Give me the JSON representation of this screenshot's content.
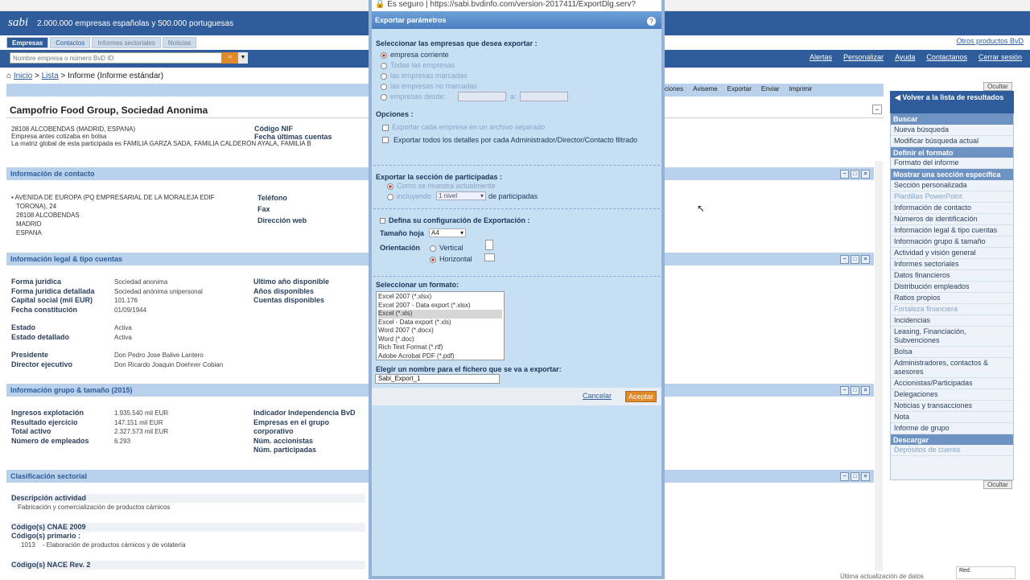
{
  "header": {
    "logo": "sabi",
    "tagline": "2.000.000 empresas españolas y 500.000 portuguesas",
    "tabs": [
      "Empresas",
      "Contactos",
      "Informes sectoriales",
      "Noticias"
    ],
    "otros": "Otros productos BvD"
  },
  "search": {
    "placeholder": "Nombre empresa o número BvD ID"
  },
  "toplinks": [
    "Alertas",
    "Personalizar",
    "Ayuda",
    "Contactanos",
    "Cerrar sesión"
  ],
  "breadcrumb": {
    "inicio": "Inicio",
    "lista": "Lista",
    "rest": " > Informe (Informe estándar)"
  },
  "actions": [
    "ciones",
    "Aviseme",
    "Exportar",
    "Enviar",
    "Imprimir"
  ],
  "company": {
    "name": "Campofrio Food Group, Sociedad Anonima",
    "line1": "28108 ALCOBENDAS (MADRID, ESPANA)",
    "line2": "Empresa antes cotizaba en bolsa",
    "line3": "La matriz global de esta participada es FAMILIA GARZA SADA, FAMILIA CALDERÓN AYALA, FAMILIA B",
    "nif_label": "Código NIF",
    "ultimas_label": "Fecha últimas cuentas"
  },
  "contact": {
    "title": "Información de contacto",
    "address": [
      "AVENIDA DE EUROPA (PQ EMPRESARIAL DE LA MORALEJA EDIF",
      "TORONA), 24",
      "28108 ALCOBENDAS",
      "MADRID",
      "ESPANA"
    ],
    "labels": [
      "Teléfono",
      "Fax",
      "Dirección web"
    ]
  },
  "legal": {
    "title": "Información legal & tipo cuentas",
    "rows": [
      {
        "label": "Forma jurídica",
        "value": "Sociedad anonima"
      },
      {
        "label": "Forma jurídica detallada",
        "value": "Sociedad anónima unipersonal"
      },
      {
        "label": "Capital social (mil EUR)",
        "value": "101.176"
      },
      {
        "label": "Fecha constitución",
        "value": "01/09/1944"
      },
      {
        "label": "Estado",
        "value": "Activa"
      },
      {
        "label": "Estado detallado",
        "value": "Activa"
      },
      {
        "label": "Presidente",
        "value": "Don Pedro Jose Balive Lantero"
      },
      {
        "label": "Director ejecutivo",
        "value": "Don Ricardo Joaquin Doehner Cobian"
      }
    ],
    "right_labels": [
      "Ultimo año disponible",
      "Años disponibles",
      "Cuentas disponibles"
    ]
  },
  "grupo": {
    "title": "Información grupo & tamaño (2015)",
    "rows": [
      {
        "label": "Ingresos explotación",
        "value": "1.935.540 mil EUR"
      },
      {
        "label": "Resultado ejercicio",
        "value": "147.151 mil EUR"
      },
      {
        "label": "Total activo",
        "value": "2.327.573 mil EUR"
      },
      {
        "label": "Número de empleados",
        "value": "6.293"
      }
    ],
    "right_labels": [
      "Indicador Independencia BvD",
      "Empresas en el grupo",
      "corporativo",
      "Núm. accionistas",
      "Núm. participadas"
    ]
  },
  "sector": {
    "title": "Clasificación sectorial",
    "desc_label": "Descripción actividad",
    "desc_value": "Fabricación y comercialización de productos cárnicos",
    "cnae_label": "Código(s) CNAE 2009",
    "primario_label": "Código(s) primario :",
    "code": "1013",
    "code_desc": "- Elaboración de productos cárnicos y de volatería",
    "nace_label": "Código(s) NACE Rev. 2"
  },
  "sidebar": {
    "ocultar": "Ocultar",
    "volver": "Volver a la lista de resultados",
    "items": [
      {
        "text": "Buscar",
        "kind": "hdr"
      },
      {
        "text": "Nueva búsqueda",
        "kind": "item"
      },
      {
        "text": "Modificar búsqueda actual",
        "kind": "item"
      },
      {
        "text": "Definir el formato",
        "kind": "hdr"
      },
      {
        "text": "Formato del informe",
        "kind": "item"
      },
      {
        "text": "Mostrar una sección específica",
        "kind": "hdr"
      },
      {
        "text": "Sección personalizada",
        "kind": "item"
      },
      {
        "text": "Plantillas PowerPoint",
        "kind": "dis"
      },
      {
        "text": "Información de contacto",
        "kind": "item"
      },
      {
        "text": "Números de identificación",
        "kind": "item"
      },
      {
        "text": "Información legal & tipo cuentas",
        "kind": "item"
      },
      {
        "text": "Información grupo & tamaño",
        "kind": "item"
      },
      {
        "text": "Actividad y visión general",
        "kind": "item"
      },
      {
        "text": "Informes sectoriales",
        "kind": "item"
      },
      {
        "text": "Datos financieros",
        "kind": "item"
      },
      {
        "text": "Distribución empleados",
        "kind": "item"
      },
      {
        "text": "Ratios propios",
        "kind": "item"
      },
      {
        "text": "Fortaleza financiera",
        "kind": "dis"
      },
      {
        "text": "Incidencias",
        "kind": "item"
      },
      {
        "text": "Leasing, Financiación, Subvenciones",
        "kind": "item"
      },
      {
        "text": "Bolsa",
        "kind": "item"
      },
      {
        "text": "Administradores, contactos & asesores",
        "kind": "item"
      },
      {
        "text": "Accionistas/Participadas",
        "kind": "item"
      },
      {
        "text": "Delegaciones",
        "kind": "item"
      },
      {
        "text": "Noticias y transacciones",
        "kind": "item"
      },
      {
        "text": "Nota",
        "kind": "item"
      },
      {
        "text": "Informe de grupo",
        "kind": "item"
      },
      {
        "text": "Descargar",
        "kind": "hdr"
      },
      {
        "text": "Depósitos de cuenta",
        "kind": "dis"
      }
    ]
  },
  "modal": {
    "url_secure": "Es seguro",
    "url": "https://sabi.bvdinfo.com/version-2017411/ExportDlg.serv?",
    "title": "Exportar parámetros",
    "sel_label": "Seleccionar las empresas que desea exportar :",
    "opts": [
      "empresa corriente",
      "Todas las empresas",
      "las empresas marcadas",
      "las empresas no marcadas",
      "empresas desde:"
    ],
    "a_label": "a:",
    "opciones_label": "Opciones :",
    "opt_sep": "Exportar cada empresa en un archivo separado",
    "opt_det": "Exportar todos los detalles por cada Administrador/Director/Contacto filtrado",
    "part_label": "Exportar la sección de participadas :",
    "part_opt1": "Como se muestra actualmente",
    "part_opt2": "incluyendo",
    "nivel": "1 nivel",
    "de_part": "de participadas",
    "config_label": "Defina su configuración de Exportación :",
    "tamano_label": "Tamaño hoja",
    "tamano_value": "A4",
    "orient_label": "Orientación",
    "vertical": "Vertical",
    "horizontal": "Horizontal",
    "formato_label": "Seleccionar un formato:",
    "formats": [
      "Excel 2007 (*.xlsx)",
      "Excel 2007 - Data export (*.xlsx)",
      "Excel (*.xls)",
      "Excel - Data export (*.xls)",
      "Word 2007 (*.docx)",
      "Word (*.doc)",
      "Rich Text Format (*.rtf)",
      "Adobe Acrobat PDF (*.pdf)"
    ],
    "fname_label": "Elegir un nombre para el fichero que se va a exportar:",
    "fname_value": "Sabi_Export_1",
    "cancelar": "Cancelar",
    "aceptar": "Aceptar"
  },
  "footer": {
    "ultima": "Última actualización de datos",
    "red": "Red"
  }
}
